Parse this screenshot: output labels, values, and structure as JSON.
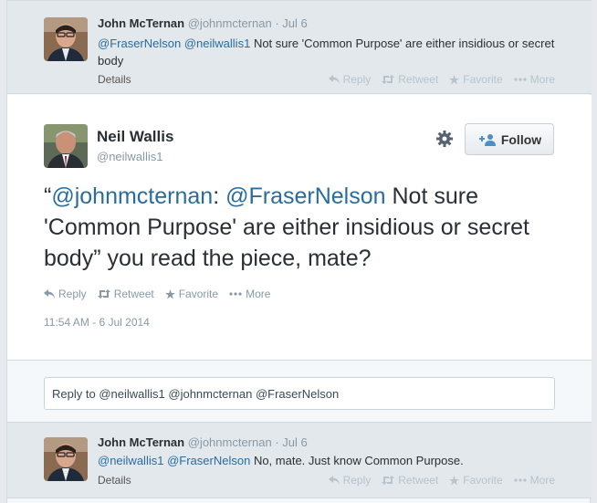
{
  "reply_tweet_1": {
    "author_name": "John McTernan",
    "author_handle": "@johnmcternan",
    "separator": "·",
    "date": "Jul 6",
    "mention_1": "@FraserNelson",
    "mention_2": "@neilwallis1",
    "text": "Not sure 'Common Purpose' are either insidious or secret body",
    "details_label": "Details",
    "actions": {
      "reply": "Reply",
      "retweet": "Retweet",
      "favorite": "Favorite",
      "more": "More"
    }
  },
  "main_tweet": {
    "author_name": "Neil Wallis",
    "author_handle": "@neilwallis1",
    "follow_label": "Follow",
    "quote_open": "“",
    "mention_1": "@johnmcternan",
    "colon": ":",
    "mention_2": "@FraserNelson",
    "text": "Not sure 'Common Purpose' are either insidious or secret body” you read the piece, mate?",
    "actions": {
      "reply": "Reply",
      "retweet": "Retweet",
      "favorite": "Favorite",
      "more": "More"
    },
    "timestamp": "11:54 AM - 6 Jul 2014"
  },
  "reply_box": {
    "prefix": "Reply to",
    "text": "@neilwallis1 @johnmcternan @FraserNelson"
  },
  "reply_tweet_2": {
    "author_name": "John McTernan",
    "author_handle": "@johnmcternan",
    "separator": "·",
    "date": "Jul 6",
    "mention_1": "@neilwallis1",
    "mention_2": "@FraserNelson",
    "text": "No, mate. Just know Common Purpose.",
    "details_label": "Details",
    "actions": {
      "reply": "Reply",
      "retweet": "Retweet",
      "favorite": "Favorite",
      "more": "More"
    }
  },
  "colors": {
    "mention": "#2a6c9e",
    "muted": "#8899a6",
    "faded_action": "#b8c3cc"
  }
}
